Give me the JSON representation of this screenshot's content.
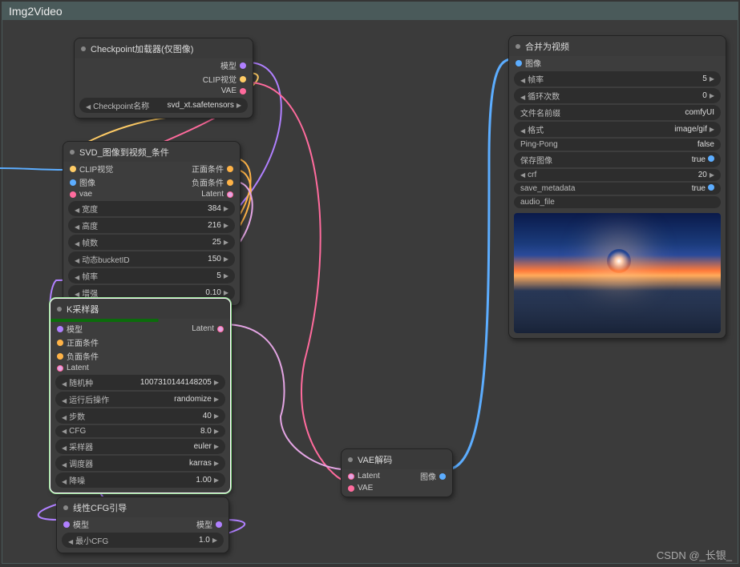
{
  "group": {
    "title": "Img2Video"
  },
  "nodes": {
    "checkpoint": {
      "title": "Checkpoint加载器(仅图像)",
      "out_model": "模型",
      "out_clip": "CLIP视觉",
      "out_vae": "VAE",
      "ckpt_label": "Checkpoint名称",
      "ckpt_value": "svd_xt.safetensors"
    },
    "svd": {
      "title": "SVD_图像到视频_条件",
      "in_clip": "CLIP视觉",
      "in_image": "图像",
      "in_vae": "vae",
      "out_pos": "正面条件",
      "out_neg": "负面条件",
      "out_latent": "Latent",
      "width_l": "宽度",
      "width_v": "384",
      "height_l": "高度",
      "height_v": "216",
      "frames_l": "帧数",
      "frames_v": "25",
      "bucket_l": "动态bucketID",
      "bucket_v": "150",
      "fps_l": "帧率",
      "fps_v": "5",
      "aug_l": "增强",
      "aug_v": "0.10"
    },
    "ksampler": {
      "title": "K采样器",
      "in_model": "模型",
      "in_pos": "正面条件",
      "in_neg": "负面条件",
      "in_latent": "Latent",
      "out_latent": "Latent",
      "seed_l": "随机种",
      "seed_v": "1007310144148205",
      "after_l": "运行后操作",
      "after_v": "randomize",
      "steps_l": "步数",
      "steps_v": "40",
      "cfg_l": "CFG",
      "cfg_v": "8.0",
      "sampler_l": "采样器",
      "sampler_v": "euler",
      "sched_l": "调度器",
      "sched_v": "karras",
      "denoise_l": "降噪",
      "denoise_v": "1.00"
    },
    "linearcfg": {
      "title": "线性CFG引导",
      "in_model": "模型",
      "out_model": "模型",
      "min_l": "最小CFG",
      "min_v": "1.0"
    },
    "vaedecode": {
      "title": "VAE解码",
      "in_latent": "Latent",
      "in_vae": "VAE",
      "out_image": "图像"
    },
    "combine": {
      "title": "合并为视频",
      "in_image": "图像",
      "fps_l": "帧率",
      "fps_v": "5",
      "loop_l": "循环次数",
      "loop_v": "0",
      "prefix_l": "文件名前缀",
      "prefix_v": "comfyUI",
      "format_l": "格式",
      "format_v": "image/gif",
      "pingpong_l": "Ping-Pong",
      "pingpong_v": "false",
      "save_l": "保存图像",
      "save_v": "true",
      "crf_l": "crf",
      "crf_v": "20",
      "meta_l": "save_metadata",
      "meta_v": "true",
      "audio_l": "audio_file"
    }
  },
  "watermark": "CSDN @_长银_"
}
